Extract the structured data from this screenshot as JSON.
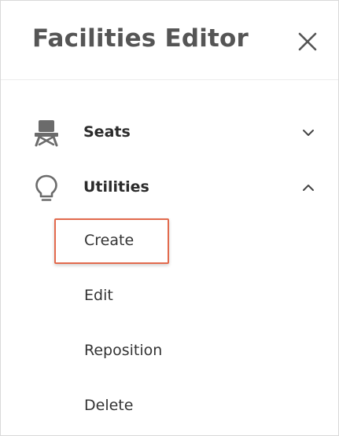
{
  "panel": {
    "title": "Facilities Editor",
    "close_icon": "close-icon"
  },
  "nav": {
    "items": [
      {
        "label": "Seats",
        "icon": "seat-icon",
        "expanded": false,
        "chevron": "chevron-down-icon"
      },
      {
        "label": "Utilities",
        "icon": "lightbulb-icon",
        "expanded": true,
        "chevron": "chevron-up-icon"
      }
    ]
  },
  "utilities_menu": {
    "items": [
      {
        "label": "Create",
        "selected": true
      },
      {
        "label": "Edit",
        "selected": false
      },
      {
        "label": "Reposition",
        "selected": false
      },
      {
        "label": "Delete",
        "selected": false
      }
    ]
  },
  "colors": {
    "title": "#555555",
    "icon": "#6b6b6b",
    "selection_border": "#e26a4d"
  }
}
